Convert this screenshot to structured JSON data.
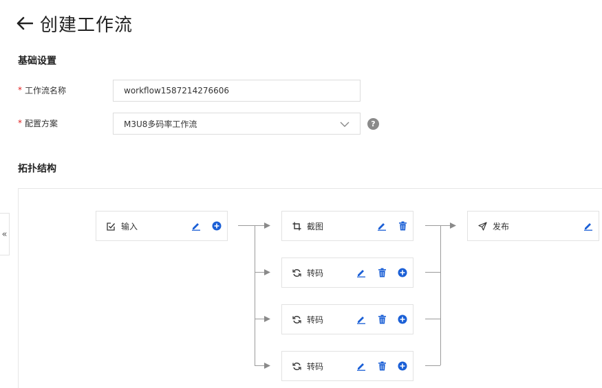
{
  "header": {
    "title": "创建工作流"
  },
  "basic": {
    "title": "基础设置",
    "name_label": "工作流名称",
    "name_value": "workflow1587214276606",
    "plan_label": "配置方案",
    "plan_value": "M3U8多码率工作流",
    "help": "?"
  },
  "topology": {
    "title": "拓扑结构",
    "input_label": "输入",
    "snapshot_label": "截图",
    "transcode_1_label": "转码",
    "transcode_2_label": "转码",
    "transcode_3_label": "转码",
    "publish_label": "发布"
  },
  "sidebar_toggle": "«",
  "colors": {
    "accent": "#1a5fd6",
    "icon_dark": "#333333",
    "line": "#9a9a9a",
    "required": "#e02020"
  },
  "icons": {
    "back": "arrow-left-icon",
    "input": "checkbox-edit-icon",
    "snapshot": "crop-icon",
    "transcode": "refresh-icon",
    "publish": "send-icon",
    "edit": "pencil-icon",
    "delete": "trash-icon",
    "add": "plus-circle-icon",
    "select": "chevron-down-icon"
  }
}
